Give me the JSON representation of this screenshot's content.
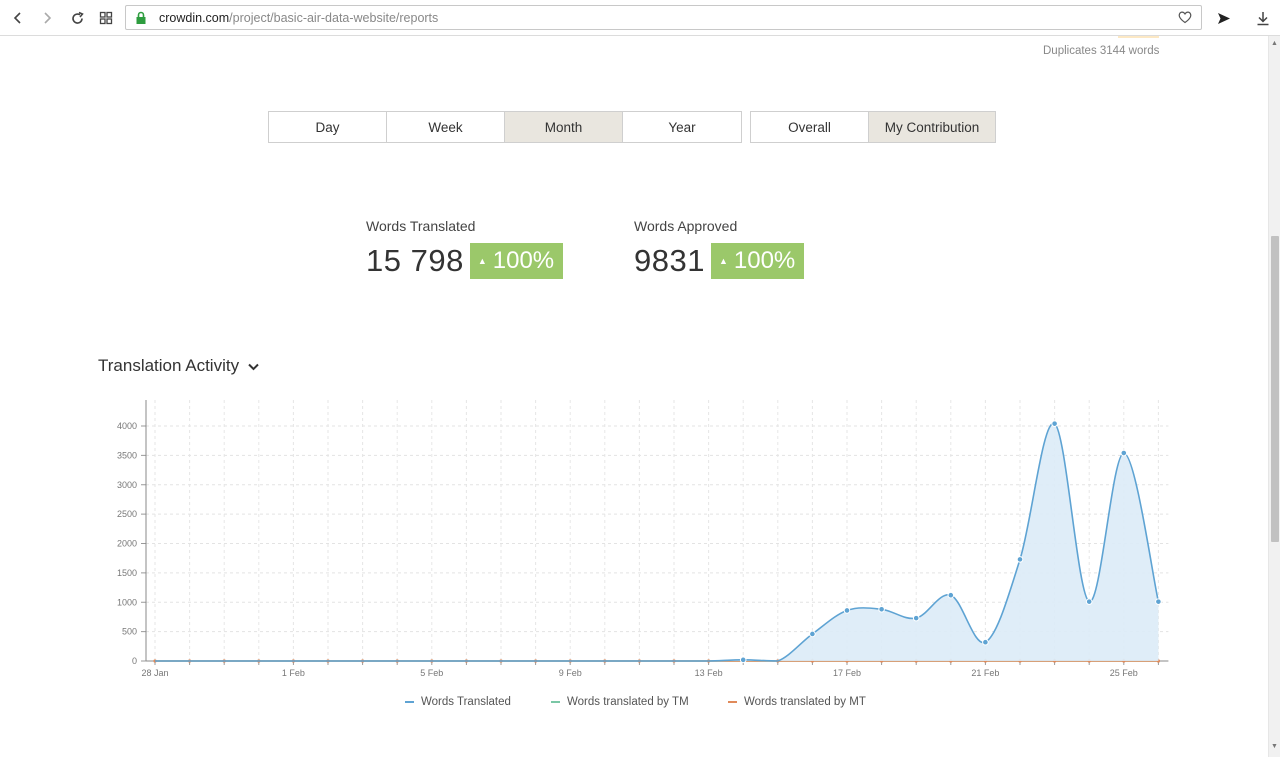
{
  "browser": {
    "url_host": "crowdin.com",
    "url_path": "/project/basic-air-data-website/reports"
  },
  "header": {
    "duplicates": "Duplicates 3144 words"
  },
  "period_tabs": [
    {
      "label": "Day",
      "active": false
    },
    {
      "label": "Week",
      "active": false
    },
    {
      "label": "Month",
      "active": true
    },
    {
      "label": "Year",
      "active": false
    }
  ],
  "scope_tabs": [
    {
      "label": "Overall",
      "active": false
    },
    {
      "label": "My Contribution",
      "active": true
    }
  ],
  "stats": {
    "translated": {
      "label": "Words Translated",
      "value": "15 798",
      "change": "100%"
    },
    "approved": {
      "label": "Words Approved",
      "value": "9831",
      "change": "100%"
    }
  },
  "section": {
    "title": "Translation Activity"
  },
  "colors": {
    "translated": "#5ea3d3",
    "translated_fill": "#dcebf7",
    "tm": "#7ac7a6",
    "mt": "#e08a5a",
    "badge": "#9bc86a"
  },
  "chart_data": {
    "type": "area",
    "x": [
      "28 Jan",
      "29 Jan",
      "30 Jan",
      "31 Jan",
      "1 Feb",
      "2 Feb",
      "3 Feb",
      "4 Feb",
      "5 Feb",
      "6 Feb",
      "7 Feb",
      "8 Feb",
      "9 Feb",
      "10 Feb",
      "11 Feb",
      "12 Feb",
      "13 Feb",
      "14 Feb",
      "15 Feb",
      "16 Feb",
      "17 Feb",
      "18 Feb",
      "19 Feb",
      "20 Feb",
      "21 Feb",
      "22 Feb",
      "23 Feb",
      "24 Feb",
      "25 Feb",
      "26 Feb"
    ],
    "x_tick_labels": [
      "28 Jan",
      "1 Feb",
      "5 Feb",
      "9 Feb",
      "13 Feb",
      "17 Feb",
      "21 Feb",
      "25 Feb"
    ],
    "y_ticks": [
      0,
      500,
      1000,
      1500,
      2000,
      2500,
      3000,
      3500,
      4000
    ],
    "ylim": [
      0,
      4400
    ],
    "grid": true,
    "legend_position": "bottom",
    "series": [
      {
        "name": "Words Translated",
        "values": [
          0,
          0,
          0,
          0,
          0,
          0,
          0,
          0,
          0,
          0,
          0,
          0,
          0,
          0,
          0,
          0,
          0,
          20,
          0,
          460,
          860,
          880,
          730,
          1120,
          320,
          1730,
          4040,
          1010,
          3540,
          1010
        ]
      },
      {
        "name": "Words translated by TM",
        "values": [
          0,
          0,
          0,
          0,
          0,
          0,
          0,
          0,
          0,
          0,
          0,
          0,
          0,
          0,
          0,
          0,
          0,
          0,
          0,
          0,
          0,
          0,
          0,
          0,
          0,
          0,
          0,
          0,
          0,
          0
        ]
      },
      {
        "name": "Words translated by MT",
        "values": [
          0,
          0,
          0,
          0,
          0,
          0,
          0,
          0,
          0,
          0,
          0,
          0,
          0,
          0,
          0,
          0,
          0,
          0,
          0,
          0,
          0,
          0,
          0,
          0,
          0,
          0,
          0,
          0,
          0,
          0
        ]
      }
    ]
  }
}
